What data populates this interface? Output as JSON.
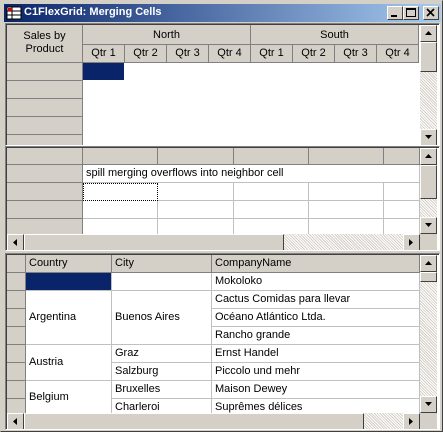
{
  "window": {
    "title": "C1FlexGrid: Merging Cells",
    "controls": [
      "minimize",
      "maximize",
      "close"
    ]
  },
  "grid1": {
    "corner_label": "Sales by Product",
    "regions": [
      "North",
      "South"
    ],
    "quarters": [
      "Qtr 1",
      "Qtr 2",
      "Qtr 3",
      "Qtr 4",
      "Qtr 1",
      "Qtr 2",
      "Qtr 3",
      "Qtr 4"
    ],
    "selected_color": "#0a246a"
  },
  "grid2": {
    "spill_text": "spill merging overflows into neighbor cell"
  },
  "grid3": {
    "headers": [
      "Country",
      "City",
      "CompanyName"
    ],
    "rows": [
      {
        "country": "",
        "city": "",
        "company": "Mokoloko"
      },
      {
        "country": "Argentina",
        "city": "Buenos Aires",
        "company": "Cactus Comidas para llevar"
      },
      {
        "country": "",
        "city": "",
        "company": "Océano Atlántico Ltda."
      },
      {
        "country": "",
        "city": "",
        "company": "Rancho grande"
      },
      {
        "country": "Austria",
        "city": "Graz",
        "company": "Ernst Handel"
      },
      {
        "country": "",
        "city": "Salzburg",
        "company": "Piccolo und mehr"
      },
      {
        "country": "Belgium",
        "city": "Bruxelles",
        "company": "Maison Dewey"
      },
      {
        "country": "",
        "city": "Charleroi",
        "company": "Suprêmes délices"
      }
    ],
    "merged_labels": {
      "argentina": "Argentina",
      "buenos_aires": "Buenos Aires",
      "austria": "Austria",
      "belgium": "Belgium"
    }
  }
}
